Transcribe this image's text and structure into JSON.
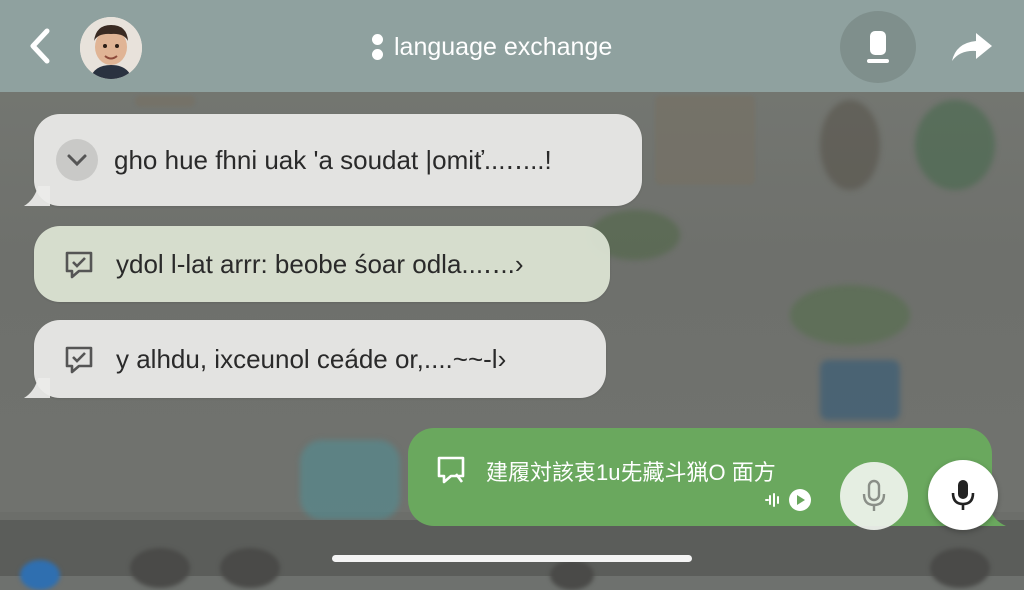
{
  "header": {
    "title": "language exchange",
    "back_icon": "chevron-left-icon",
    "avatar": "avatar",
    "action1_icon": "download-icon",
    "action2_icon": "share-arrow-icon"
  },
  "messages": [
    {
      "icon": "chevron-down-icon",
      "text": "gho hue fhni uak 'a soudat |omiť...‥...!"
    },
    {
      "icon": "chat-check-icon",
      "text": "ydol l-lat arrr: beobe śoar odla...‥..›"
    },
    {
      "icon": "chat-check-icon",
      "text": "y alhdu, ixceunol ceáde or,....~~-l›"
    }
  ],
  "my_message": {
    "text": "建履対該衷1u兂藏斗猟O 面方",
    "icon": "chat-quote-icon",
    "audio_icon": "audio-play-icon"
  },
  "controls": {
    "mic_secondary_icon": "microphone-icon",
    "mic_primary_icon": "microphone-icon"
  },
  "colors": {
    "header_bg": "#8fa19f",
    "my_bubble": "#6aa85e",
    "other_bubble": "#ececea"
  }
}
